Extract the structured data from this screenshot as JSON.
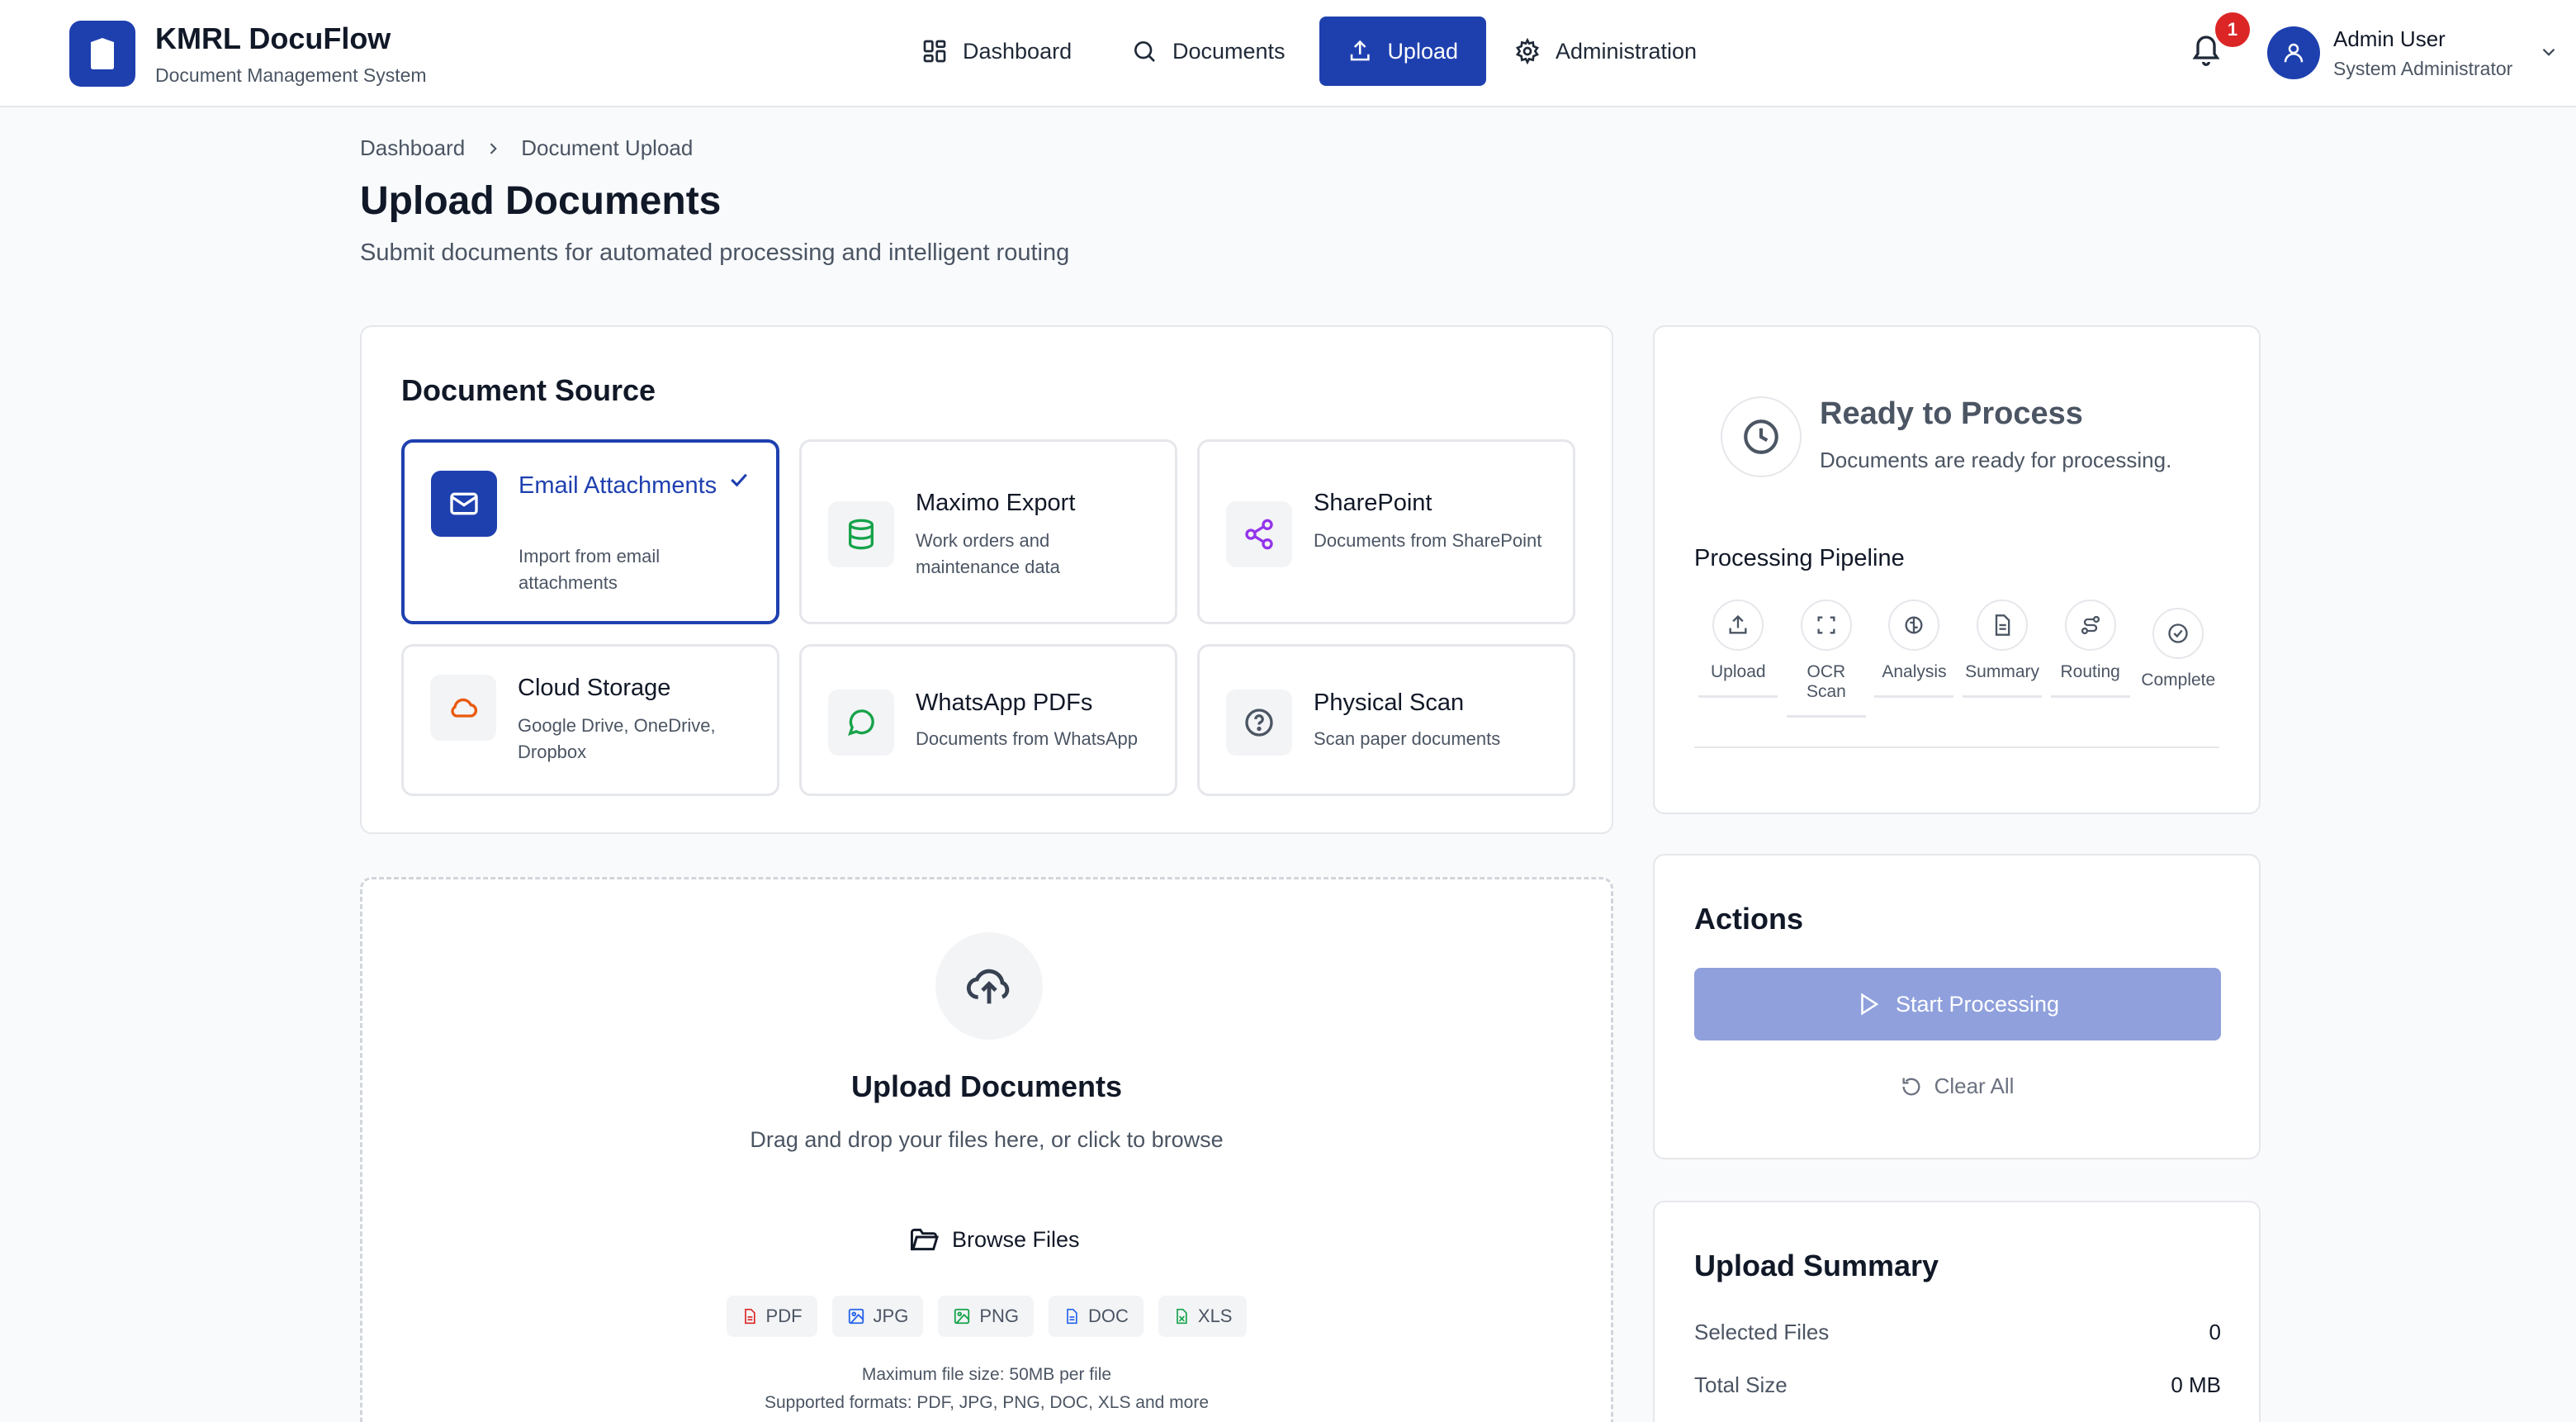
{
  "app": {
    "title": "KMRL DocuFlow",
    "subtitle": "Document Management System"
  },
  "nav": {
    "items": [
      {
        "label": "Dashboard",
        "icon": "grid-icon"
      },
      {
        "label": "Documents",
        "icon": "search-icon"
      },
      {
        "label": "Upload",
        "icon": "upload-icon",
        "active": true
      },
      {
        "label": "Administration",
        "icon": "gear-icon"
      }
    ]
  },
  "notifications": {
    "count": "1"
  },
  "user": {
    "name": "Admin User",
    "role": "System Administrator"
  },
  "breadcrumb": {
    "home": "Dashboard",
    "current": "Document Upload"
  },
  "page": {
    "title": "Upload Documents",
    "subtitle": "Submit documents for automated processing and intelligent routing"
  },
  "source": {
    "title": "Document Source",
    "items": [
      {
        "label": "Email Attachments",
        "desc": "Import from email attachments",
        "icon": "mail-icon",
        "selected": true
      },
      {
        "label": "Maximo Export",
        "desc": "Work orders and maintenance data",
        "icon": "database-icon"
      },
      {
        "label": "SharePoint",
        "desc": "Documents from SharePoint",
        "icon": "share-icon"
      },
      {
        "label": "Cloud Storage",
        "desc": "Google Drive, OneDrive, Dropbox",
        "icon": "cloud-icon"
      },
      {
        "label": "WhatsApp PDFs",
        "desc": "Documents from WhatsApp",
        "icon": "chat-icon"
      },
      {
        "label": "Physical Scan",
        "desc": "Scan paper documents",
        "icon": "help-circle-icon"
      }
    ]
  },
  "upload": {
    "title": "Upload Documents",
    "hint": "Drag and drop your files here, or click to browse",
    "browse": "Browse Files",
    "formats": [
      "PDF",
      "JPG",
      "PNG",
      "DOC",
      "XLS"
    ],
    "size_note": "Maximum file size: 50MB per file",
    "formats_note": "Supported formats: PDF, JPG, PNG, DOC, XLS and more"
  },
  "status": {
    "title": "Ready to Process",
    "desc": "Documents are ready for processing.",
    "pipeline_title": "Processing Pipeline",
    "stages": [
      "Upload",
      "OCR Scan",
      "Analysis",
      "Summary",
      "Routing",
      "Complete"
    ]
  },
  "actions": {
    "title": "Actions",
    "start": "Start Processing",
    "clear": "Clear All"
  },
  "summary": {
    "title": "Upload Summary",
    "rows": [
      {
        "label": "Selected Files",
        "value": "0"
      },
      {
        "label": "Total Size",
        "value": "0 MB"
      }
    ]
  },
  "colors": {
    "primary": "#1e40af",
    "badge": "#dc2626",
    "start_disabled": "#8fa0dc"
  }
}
